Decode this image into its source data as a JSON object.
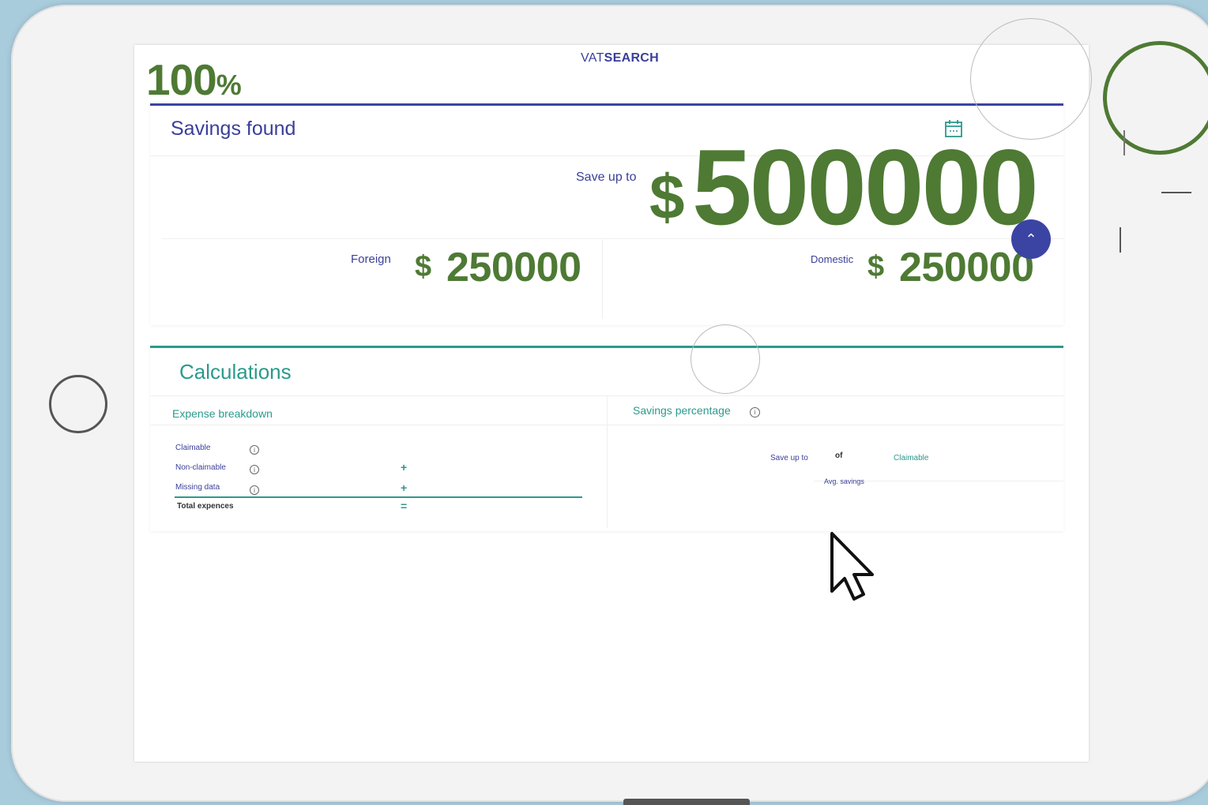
{
  "completion": {
    "value": "100",
    "sign": "%"
  },
  "brand": {
    "prefix": "VAT",
    "name": "SEARCH"
  },
  "savings": {
    "title": "Savings found",
    "save_label": "Save up to",
    "currency": "$",
    "total": "500000",
    "foreign": {
      "label": "Foreign",
      "currency": "$",
      "amount": "250000"
    },
    "domestic": {
      "label": "Domestic",
      "currency": "$",
      "amount": "250000"
    },
    "collapse_icon": "chevron-up-icon",
    "calendar_icon": "calendar-icon"
  },
  "calculations": {
    "title": "Calculations",
    "expense_breakdown": {
      "title": "Expense breakdown",
      "rows": [
        {
          "label": "Claimable",
          "operator": ""
        },
        {
          "label": "Non-claimable",
          "operator": "+"
        },
        {
          "label": "Missing data",
          "operator": "+"
        },
        {
          "label": "Total expences",
          "operator": "="
        }
      ]
    },
    "savings_percentage": {
      "title": "Savings percentage",
      "save_label": "Save up to",
      "of_label": "of",
      "claimable_label": "Claimable",
      "avg_label": "Avg. savings"
    }
  },
  "colors": {
    "accent_green": "#4e7a34",
    "brand_blue": "#3b44a3",
    "teal": "#2a9a8c"
  }
}
